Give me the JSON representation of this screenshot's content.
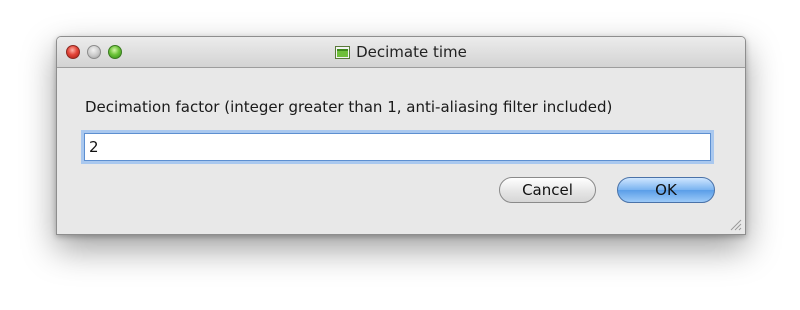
{
  "window": {
    "title": "Decimate time",
    "title_icon": "window-app-icon"
  },
  "dialog": {
    "prompt": "Decimation factor (integer greater than 1, anti-aliasing filter included)",
    "input_value": "2",
    "cancel_label": "Cancel",
    "ok_label": "OK"
  },
  "colors": {
    "ok_accent": "#6aa7ec",
    "focus_ring": "#a9c8ef",
    "window_bg": "#e8e8e8"
  }
}
